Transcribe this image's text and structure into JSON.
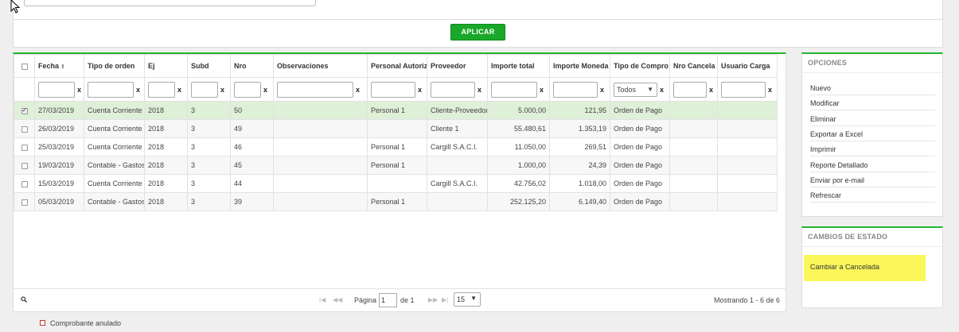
{
  "top": {
    "apply_label": "APLICAR"
  },
  "grid": {
    "headers": [
      "Fecha",
      "Tipo de orden",
      "Ej",
      "Subd",
      "Nro",
      "Observaciones",
      "Personal Autoriz",
      "Proveedor",
      "Importe total",
      "Importe Moneda",
      "Tipo de Compro",
      "Nro Cancela",
      "Usuario Carga"
    ],
    "type_filter": "Todos",
    "clear_symbol": "x",
    "rows": [
      {
        "fecha": "27/03/2019",
        "tipo": "Cuenta Corriente",
        "ej": "2018",
        "subd": "3",
        "nro": "50",
        "obs": "",
        "personal": "Personal 1",
        "proveedor": "Cliente-Proveedor",
        "total": "5.000,00",
        "moneda": "121,95",
        "comprobante": "Orden de Pago",
        "cancela": "",
        "usuario": "",
        "checked": true
      },
      {
        "fecha": "26/03/2019",
        "tipo": "Cuenta Corriente",
        "ej": "2018",
        "subd": "3",
        "nro": "49",
        "obs": "",
        "personal": "",
        "proveedor": "Cliente 1",
        "total": "55.480,61",
        "moneda": "1.353,19",
        "comprobante": "Orden de Pago",
        "cancela": "",
        "usuario": "",
        "checked": false
      },
      {
        "fecha": "25/03/2019",
        "tipo": "Cuenta Corriente",
        "ej": "2018",
        "subd": "3",
        "nro": "46",
        "obs": "",
        "personal": "Personal 1",
        "proveedor": "Cargill S.A.C.I.",
        "total": "11.050,00",
        "moneda": "269,51",
        "comprobante": "Orden de Pago",
        "cancela": "",
        "usuario": "",
        "checked": false
      },
      {
        "fecha": "19/03/2019",
        "tipo": "Contable - Gastos",
        "ej": "2018",
        "subd": "3",
        "nro": "45",
        "obs": "",
        "personal": "Personal 1",
        "proveedor": "",
        "total": "1.000,00",
        "moneda": "24,39",
        "comprobante": "Orden de Pago",
        "cancela": "",
        "usuario": "",
        "checked": false
      },
      {
        "fecha": "15/03/2019",
        "tipo": "Cuenta Corriente",
        "ej": "2018",
        "subd": "3",
        "nro": "44",
        "obs": "",
        "personal": "",
        "proveedor": "Cargill S.A.C.I.",
        "total": "42.756,02",
        "moneda": "1.018,00",
        "comprobante": "Orden de Pago",
        "cancela": "",
        "usuario": "",
        "checked": false
      },
      {
        "fecha": "05/03/2019",
        "tipo": "Contable - Gastos",
        "ej": "2018",
        "subd": "3",
        "nro": "39",
        "obs": "",
        "personal": "Personal 1",
        "proveedor": "",
        "total": "252.125,20",
        "moneda": "6.149,40",
        "comprobante": "Orden de Pago",
        "cancela": "",
        "usuario": "",
        "checked": false
      }
    ]
  },
  "pager": {
    "page_label": "Página",
    "page_value": "1",
    "of_label": "de 1",
    "page_size": "15",
    "showing": "Mostrando 1 - 6 de 6"
  },
  "legend": {
    "label": "Comprobante anulado"
  },
  "options": {
    "title": "OPCIONES",
    "items": [
      "Nuevo",
      "Modificar",
      "Eliminar",
      "Exportar a Excel",
      "Imprimir",
      "Reporte Detallado",
      "Enviar por e-mail",
      "Refrescar"
    ]
  },
  "state": {
    "title": "CAMBIOS DE ESTADO",
    "items": [
      "Cambiar a Cancelada"
    ]
  },
  "colors": {
    "accent": "#22b532",
    "apply_button": "#1aa82a",
    "selected_row": "#dff0d8",
    "highlight": "#fbf75a",
    "annulled_marker": "#c0392b"
  }
}
